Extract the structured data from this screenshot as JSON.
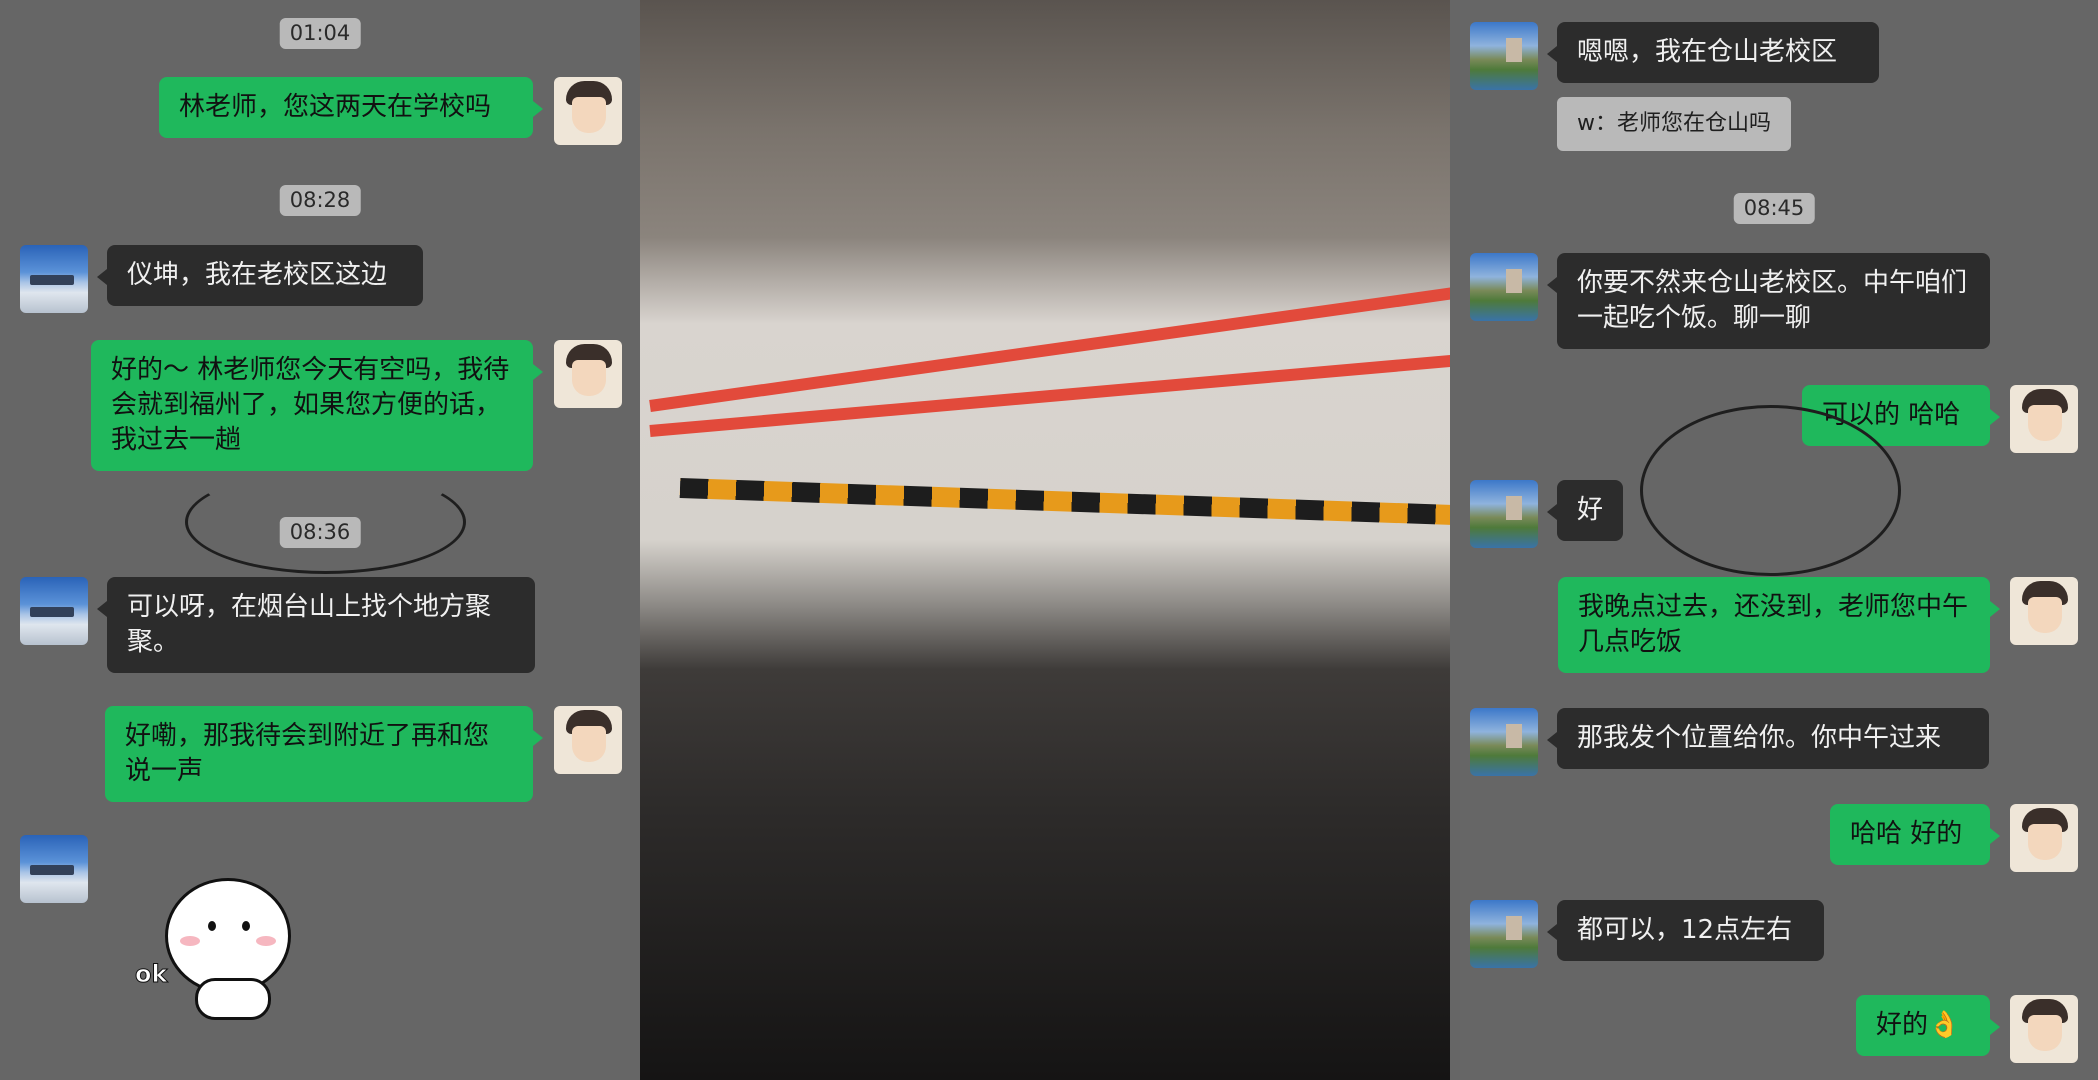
{
  "left_chat": {
    "time1": "01:04",
    "msg1": "林老师，您这两天在学校吗",
    "time2": "08:28",
    "msg2": "仪坤，我在老校区这边",
    "msg3": "好的～ 林老师您今天有空吗，我待会就到福州了，如果您方便的话，我过去一趟",
    "time3": "08:36",
    "msg4": "可以呀，在烟台山上找个地方聚聚。",
    "msg5": "好嘞，那我待会到附近了再和您说一声",
    "sticker_text": "ok"
  },
  "right_chat": {
    "msg1": "嗯嗯，我在仓山老校区",
    "quote1": "w：老师您在仓山吗",
    "time1": "08:45",
    "msg2": "你要不然来仓山老校区。中午咱们一起吃个饭。聊一聊",
    "msg3": "可以的 哈哈",
    "msg4": "好",
    "msg5": "我晚点过去，还没到，老师您中午几点吃饭",
    "msg6": "那我发个位置给你。你中午过来",
    "msg7": "哈哈 好的",
    "msg8": "都可以，12点左右",
    "msg9": "好的👌"
  },
  "colors": {
    "chat_background": "#666666",
    "outgoing_bubble": "#1fb85c",
    "incoming_bubble": "#2c2c2c",
    "timestamp_badge": "#b9b9b9"
  }
}
